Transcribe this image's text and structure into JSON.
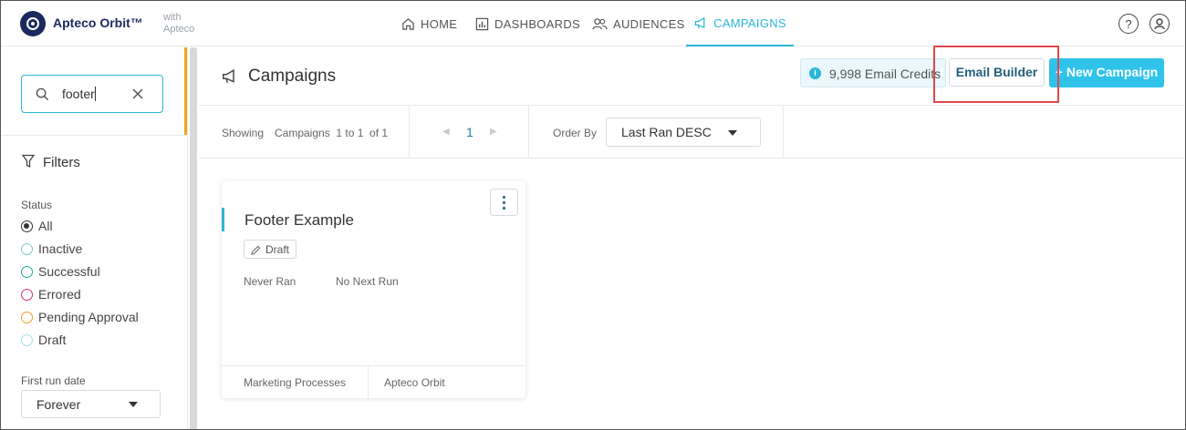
{
  "app": {
    "brand": "Apteco Orbit™",
    "with_label": "with",
    "with_company": "Apteco"
  },
  "nav": {
    "items": [
      {
        "label": "HOME",
        "icon": "home-icon"
      },
      {
        "label": "DASHBOARDS",
        "icon": "dashboard-icon"
      },
      {
        "label": "AUDIENCES",
        "icon": "audiences-icon"
      },
      {
        "label": "CAMPAIGNS",
        "icon": "megaphone-icon",
        "active": true
      }
    ],
    "help_icon": "help-icon",
    "user_icon": "user-icon"
  },
  "sidebar": {
    "search": {
      "value": "footer"
    },
    "filters_title": "Filters",
    "status_label": "Status",
    "statuses": [
      {
        "label": "All",
        "checked": true,
        "color": "#333333"
      },
      {
        "label": "Inactive",
        "checked": false,
        "color": "#7ec9c6"
      },
      {
        "label": "Successful",
        "checked": false,
        "color": "#2aa79b"
      },
      {
        "label": "Errored",
        "checked": false,
        "color": "#d6336c"
      },
      {
        "label": "Pending Approval",
        "checked": false,
        "color": "#f0a020"
      },
      {
        "label": "Draft",
        "checked": false,
        "color": "#a9dbe8"
      }
    ],
    "first_run_label": "First run date",
    "first_run_value": "Forever"
  },
  "main": {
    "title": "Campaigns",
    "credits": "9,998 Email Credits",
    "email_builder": "Email Builder",
    "new_campaign": "+ New Campaign",
    "toolbar": {
      "showing": "Showing",
      "campaigns_range": "Campaigns  1 to 1  of 1",
      "page": "1",
      "order_by_label": "Order By",
      "order_by_value": "Last Ran DESC"
    },
    "cards": [
      {
        "title": "Footer Example",
        "status": "Draft",
        "last_run": "Never Ran",
        "next_run": "No Next Run",
        "footer_left": "Marketing Processes",
        "footer_right": "Apteco Orbit"
      }
    ]
  },
  "colors": {
    "accent": "#2bb6d8",
    "primary_button": "#2fc3ea",
    "highlight_box": "#e0474c",
    "sidebar_accent": "#f4a31c"
  }
}
